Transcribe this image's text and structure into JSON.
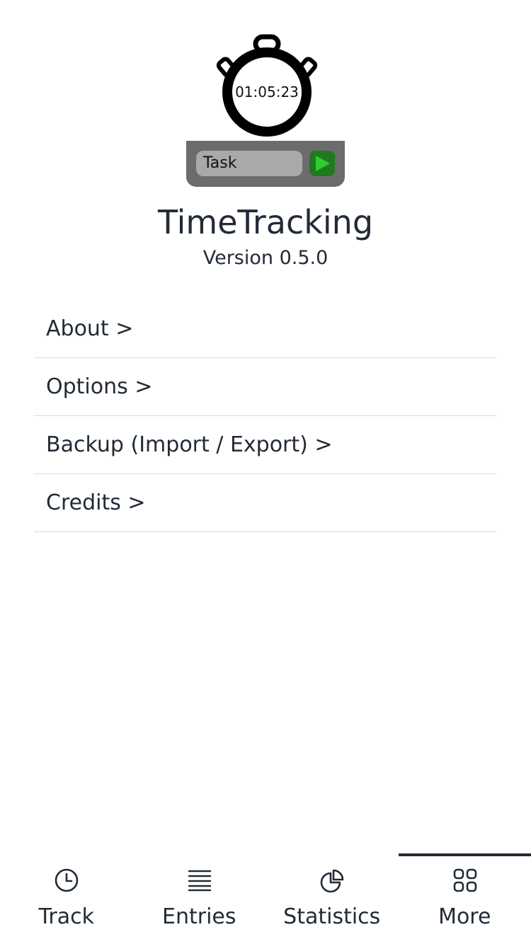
{
  "logo": {
    "timer_text": "01:05:23",
    "task_text": "Task",
    "play_color": "#2ecc2e",
    "icon": "stopwatch-icon"
  },
  "app": {
    "title": "TimeTracking",
    "version": "Version 0.5.0"
  },
  "menu": {
    "items": [
      {
        "label": "About >"
      },
      {
        "label": "Options >"
      },
      {
        "label": "Backup (Import / Export) >"
      },
      {
        "label": "Credits >"
      }
    ]
  },
  "tabs": {
    "items": [
      {
        "label": "Track",
        "icon": "clock-icon",
        "active": false
      },
      {
        "label": "Entries",
        "icon": "list-icon",
        "active": false
      },
      {
        "label": "Statistics",
        "icon": "pie-chart-icon",
        "active": false
      },
      {
        "label": "More",
        "icon": "grid-icon",
        "active": true
      }
    ]
  },
  "colors": {
    "text": "#222b36",
    "divider": "#dcdcdc",
    "logo_bar": "#6c6c6c",
    "logo_task_field": "#a9a9a9",
    "logo_play_bg": "#1f7a1f"
  }
}
